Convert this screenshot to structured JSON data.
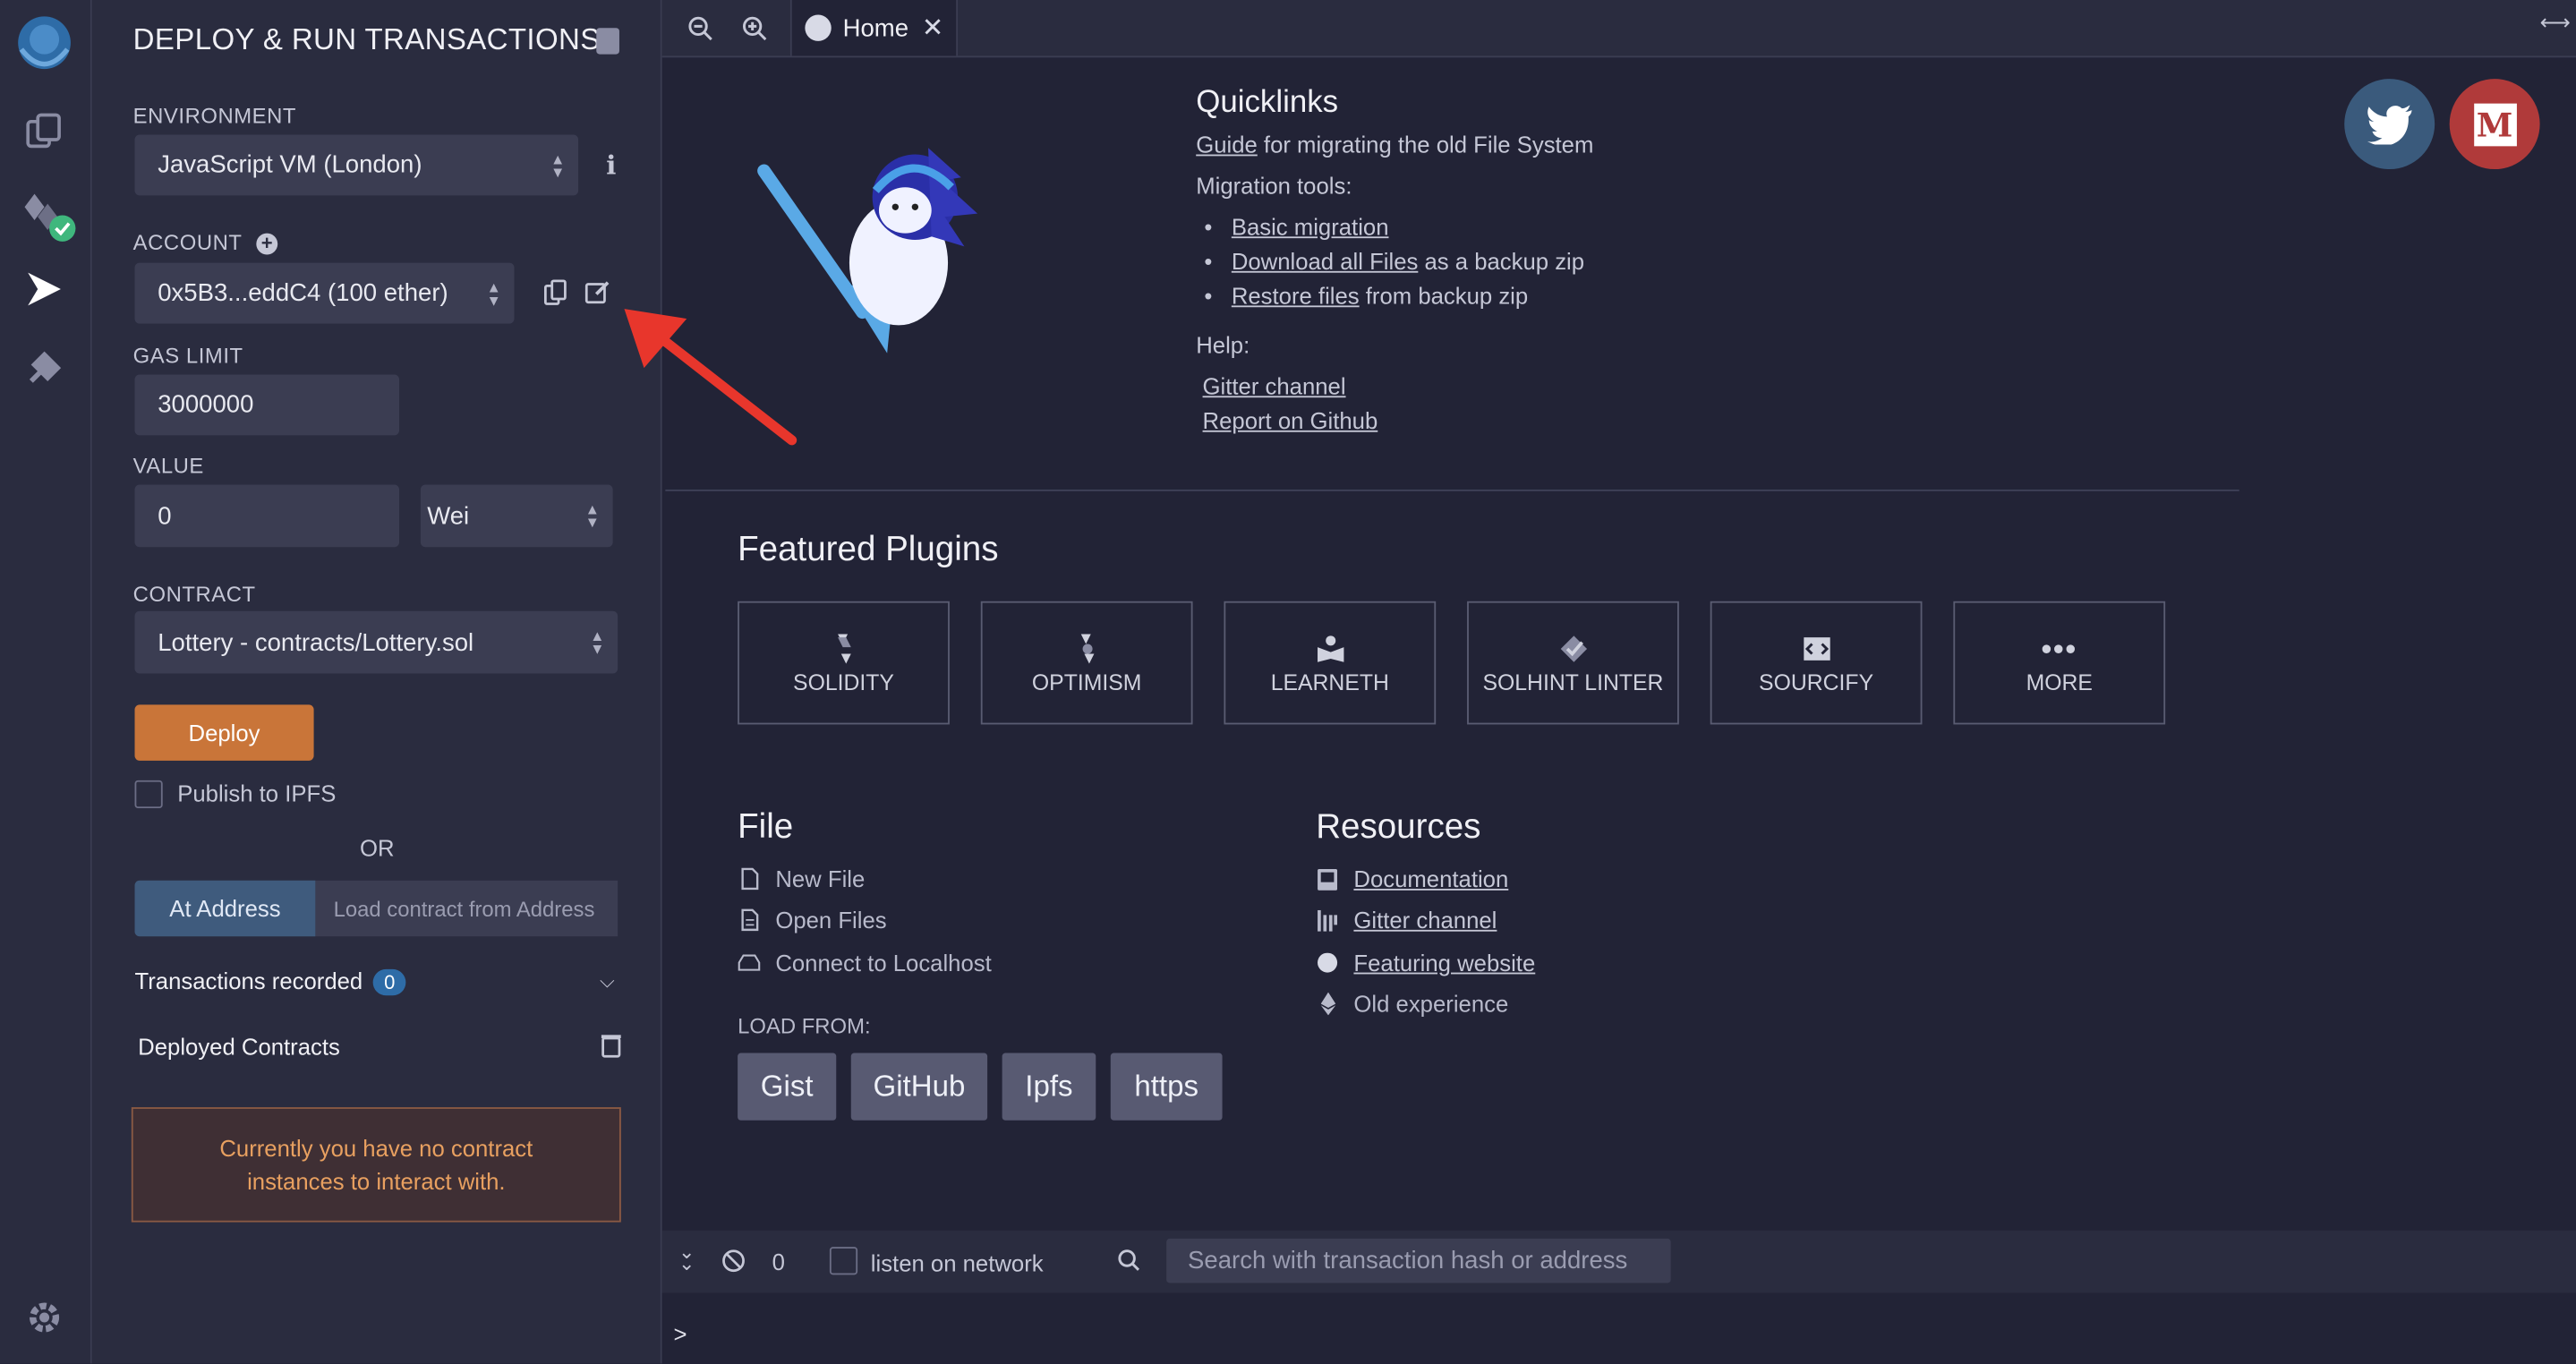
{
  "panel": {
    "title": "DEPLOY & RUN TRANSACTIONS",
    "environment_label": "ENVIRONMENT",
    "environment_value": "JavaScript VM (London)",
    "account_label": "ACCOUNT",
    "account_value": "0x5B3...eddC4 (100 ether)",
    "gas_limit_label": "GAS LIMIT",
    "gas_limit_value": "3000000",
    "value_label": "VALUE",
    "value_amount": "0",
    "value_unit": "Wei",
    "contract_label": "CONTRACT",
    "contract_value": "Lottery - contracts/Lottery.sol",
    "deploy_label": "Deploy",
    "publish_label": "Publish to IPFS",
    "or_label": "OR",
    "at_address_label": "At Address",
    "load_address_placeholder": "Load contract from Address",
    "transactions_label": "Transactions recorded",
    "transactions_count": "0",
    "deployed_label": "Deployed Contracts",
    "warning_line1": "Currently you have no contract",
    "warning_line2": "instances to interact with."
  },
  "tabs": {
    "home_label": "Home"
  },
  "home": {
    "quicklinks_title": "Quicklinks",
    "guide_link": "Guide",
    "guide_text": " for migrating the old File System",
    "migration_label": "Migration tools:",
    "basic_migration": "Basic migration",
    "download_all": "Download all Files",
    "download_text": " as a backup zip",
    "restore_files": "Restore files",
    "restore_text": " from backup zip",
    "help_label": "Help:",
    "gitter_channel": "Gitter channel",
    "report_github": "Report on Github",
    "featured_title": "Featured Plugins",
    "plugins": [
      "SOLIDITY",
      "OPTIMISM",
      "LEARNETH",
      "SOLHINT LINTER",
      "SOURCIFY",
      "MORE"
    ],
    "file_title": "File",
    "new_file": "New File",
    "open_files": "Open Files",
    "connect_localhost": "Connect to Localhost",
    "load_from_label": "LOAD FROM:",
    "load_buttons": [
      "Gist",
      "GitHub",
      "Ipfs",
      "https"
    ],
    "resources_title": "Resources",
    "documentation": "Documentation",
    "gitter_channel_res": "Gitter channel",
    "featuring_website": "Featuring website",
    "old_experience": "Old experience"
  },
  "terminal": {
    "count": "0",
    "listen_label": "listen on network",
    "search_placeholder": "Search with transaction hash or address",
    "prompt": ">"
  },
  "colors": {
    "accent_deploy": "#c97539",
    "at_address_bg": "#3f5b7d",
    "twitter_bg": "#3a5a7c",
    "medium_bg": "#b03a3a",
    "arrow": "#e8362c"
  }
}
